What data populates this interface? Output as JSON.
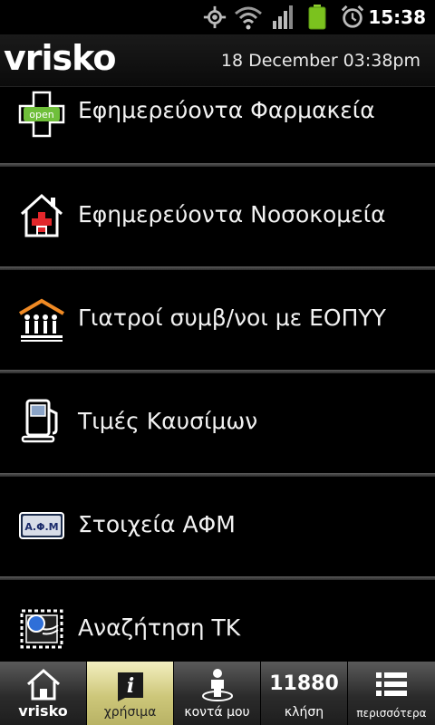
{
  "status_bar": {
    "time": "15:38",
    "icons": [
      "gps-icon",
      "wifi-icon",
      "signal-icon",
      "battery-icon",
      "alarm-icon"
    ]
  },
  "header": {
    "logo": "vrisko",
    "date": "18 December 03:38pm"
  },
  "menu": {
    "items": [
      {
        "label": "Εφημερεύοντα Φαρμακεία",
        "icon": "pharmacy-icon",
        "icon_text": "open"
      },
      {
        "label": "Εφημερεύοντα Νοσοκομεία",
        "icon": "hospital-icon"
      },
      {
        "label": "Γιατροί συμβ/νοι με ΕΟΠΥΥ",
        "icon": "doctors-icon"
      },
      {
        "label": "Τιμές Καυσίμων",
        "icon": "fuel-pump-icon"
      },
      {
        "label": "Στοιχεία ΑΦΜ",
        "icon": "afm-icon",
        "icon_text": "Α.Φ.Μ"
      },
      {
        "label": "Αναζήτηση ΤΚ",
        "icon": "postal-stamp-icon"
      }
    ]
  },
  "bottom_nav": {
    "tabs": [
      {
        "label": "vrisko",
        "icon": "home-icon"
      },
      {
        "label": "χρήσιμα",
        "icon": "info-icon",
        "active": true
      },
      {
        "label": "κοντά μου",
        "icon": "person-nearby-icon"
      },
      {
        "label": "κλήση",
        "big": "11880"
      },
      {
        "label": "περισσότερα",
        "icon": "more-list-icon"
      }
    ]
  },
  "colors": {
    "active_tab": "#cdc77a",
    "hospital_cross": "#e3272b",
    "doctors_roof": "#f08a24",
    "pharmacy_green": "#6fbf3a"
  }
}
